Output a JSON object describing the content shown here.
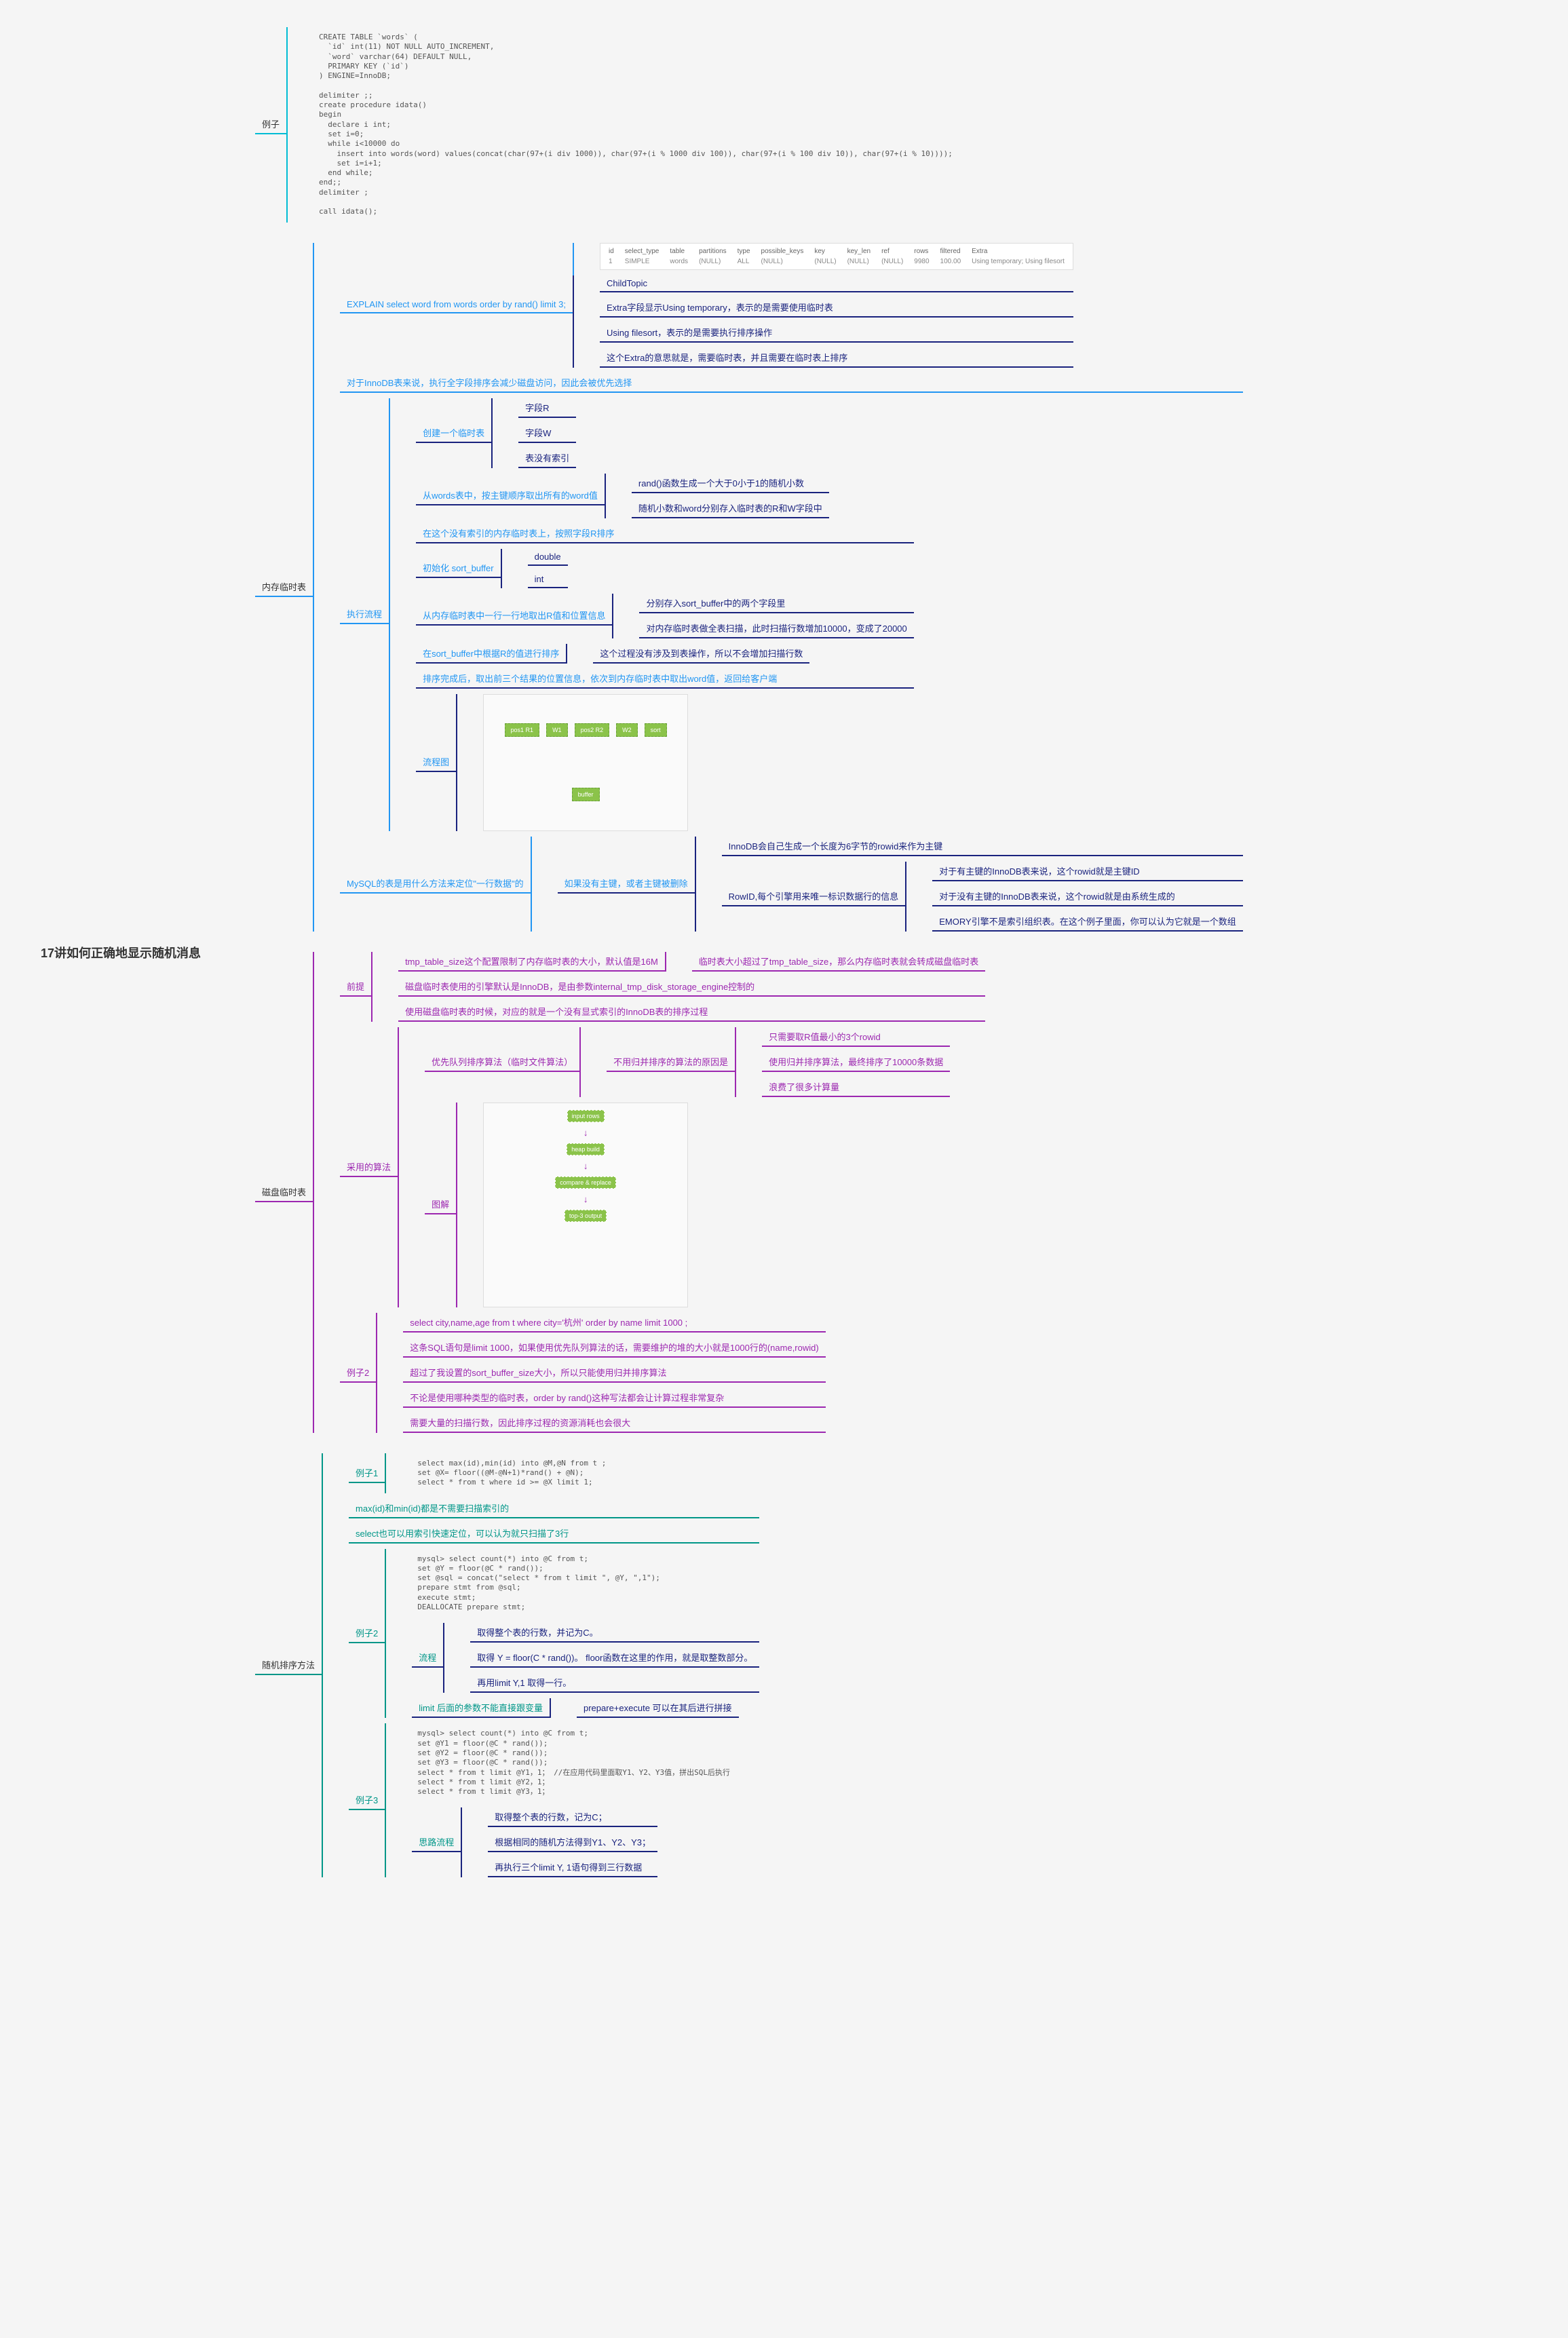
{
  "root": "17讲如何正确地显示随机消息",
  "example": {
    "title": "例子",
    "code": "CREATE TABLE `words` (\n  `id` int(11) NOT NULL AUTO_INCREMENT,\n  `word` varchar(64) DEFAULT NULL,\n  PRIMARY KEY (`id`)\n) ENGINE=InnoDB;\n\ndelimiter ;;\ncreate procedure idata()\nbegin\n  declare i int;\n  set i=0;\n  while i<10000 do\n    insert into words(word) values(concat(char(97+(i div 1000)), char(97+(i % 1000 div 100)), char(97+(i % 100 div 10)), char(97+(i % 10))));\n    set i=i+1;\n  end while;\nend;;\ndelimiter ;\n\ncall idata();"
  },
  "mem": {
    "title": "内存临时表",
    "explain_sql": "EXPLAIN select word from words order by rand() limit 3;",
    "explain_header": [
      "id",
      "select_type",
      "table",
      "partitions",
      "type",
      "possible_keys",
      "key",
      "key_len",
      "ref",
      "rows",
      "filtered",
      "Extra"
    ],
    "explain_row": [
      "1",
      "SIMPLE",
      "words",
      "(NULL)",
      "ALL",
      "(NULL)",
      "(NULL)",
      "(NULL)",
      "(NULL)",
      "9980",
      "100.00",
      "Using temporary; Using filesort"
    ],
    "explain_notes": {
      "n0": "ChildTopic",
      "n1": "Extra字段显示Using temporary，表示的是需要使用临时表",
      "n2": "Using filesort，表示的是需要执行排序操作",
      "n3": "这个Extra的意思就是，需要临时表，并且需要在临时表上排序"
    },
    "innodb_note": "对于InnoDB表来说，执行全字段排序会减少磁盘访问，因此会被优先选择",
    "flow": {
      "title": "执行流程",
      "create": "创建一个临时表",
      "create_c1": "字段R",
      "create_c2": "字段W",
      "create_c3": "表没有索引",
      "from_words": "从words表中，按主键顺序取出所有的word值",
      "from_words_c1": "rand()函数生成一个大于0小于1的随机小数",
      "from_words_c2": "随机小数和word分别存入临时表的R和W字段中",
      "sort_on": "在这个没有索引的内存临时表上，按照字段R排序",
      "init_buf": "初始化 sort_buffer",
      "init_buf_c1": "double",
      "init_buf_c2": "int",
      "extract": "从内存临时表中一行一行地取出R值和位置信息",
      "extract_c1": "分别存入sort_buffer中的两个字段里",
      "extract_c2": "对内存临时表做全表扫描，此时扫描行数增加10000，变成了20000",
      "sort_buf": "在sort_buffer中根据R的值进行排序",
      "sort_buf_note": "这个过程没有涉及到表操作，所以不会增加扫描行数",
      "done": "排序完成后，取出前三个结果的位置信息，依次到内存临时表中取出word值，返回给客户端",
      "diagram": "流程图"
    },
    "rowid": {
      "q": "MySQL的表是用什么方法来定位\"一行数据\"的",
      "a": "如果没有主键，或者主键被删除",
      "innodb_auto": "InnoDB会自己生成一个长度为6字节的rowid来作为主键",
      "rowid_def": "RowID,每个引擎用来唯一标识数据行的信息",
      "r1": "对于有主键的InnoDB表来说，这个rowid就是主键ID",
      "r2": "对于没有主键的InnoDB表来说，这个rowid就是由系统生成的",
      "r3": "EMORY引擎不是索引组织表。在这个例子里面，你可以认为它就是一个数组"
    }
  },
  "disk": {
    "title": "磁盘临时表",
    "pre": {
      "title": "前提",
      "p1": "tmp_table_size这个配置限制了内存临时表的大小，默认值是16M",
      "p1_note": "临时表大小超过了tmp_table_size，那么内存临时表就会转成磁盘临时表",
      "p2": "磁盘临时表使用的引擎默认是InnoDB，是由参数internal_tmp_disk_storage_engine控制的",
      "p3": "使用磁盘临时表的时候，对应的就是一个没有显式索引的InnoDB表的排序过程"
    },
    "algo": {
      "title": "采用的算法",
      "priority": "优先队列排序算法（临时文件算法）",
      "reason": "不用归并排序的算法的原因是",
      "r1": "只需要取R值最小的3个rowid",
      "r2": "使用归并排序算法，最终排序了10000条数据",
      "r3": "浪费了很多计算量",
      "diagram": "图解"
    },
    "ex2": {
      "title": "例子2",
      "sql": "select city,name,age from t where city='杭州' order by name limit 1000  ;",
      "n1": "这条SQL语句是limit 1000，如果使用优先队列算法的话，需要维护的堆的大小就是1000行的(name,rowid)",
      "n2": "超过了我设置的sort_buffer_size大小，所以只能使用归并排序算法",
      "n3": "不论是使用哪种类型的临时表，order by rand()这种写法都会让计算过程非常复杂",
      "n4": "需要大量的扫描行数，因此排序过程的资源消耗也会很大"
    }
  },
  "random": {
    "title": "随机排序方法",
    "ex1": {
      "title": "例子1",
      "code": "select max(id),min(id) into @M,@N from t ;\nset @X= floor((@M-@N+1)*rand() + @N);\nselect * from t where id >= @X limit 1;"
    },
    "note1": "max(id)和min(id)都是不需要扫描索引的",
    "note2": "select也可以用索引快速定位，可以认为就只扫描了3行",
    "ex2": {
      "title": "例子2",
      "code": "mysql> select count(*) into @C from t;\nset @Y = floor(@C * rand());\nset @sql = concat(\"select * from t limit \", @Y, \",1\");\nprepare stmt from @sql;\nexecute stmt;\nDEALLOCATE prepare stmt;",
      "flow": "流程",
      "f1": "取得整个表的行数，并记为C。",
      "f2": "取得 Y = floor(C * rand())。 floor函数在这里的作用，就是取整数部分。",
      "f3": "再用limit Y,1 取得一行。",
      "limit_note": "limit 后面的参数不能直接跟变量",
      "limit_sol": "prepare+execute 可以在其后进行拼接"
    },
    "ex3": {
      "title": "例子3",
      "code": "mysql> select count(*) into @C from t;\nset @Y1 = floor(@C * rand());\nset @Y2 = floor(@C * rand());\nset @Y3 = floor(@C * rand());\nselect * from t limit @Y1，1； //在应用代码里面取Y1、Y2、Y3值，拼出SQL后执行\nselect * from t limit @Y2，1；\nselect * from t limit @Y3，1；",
      "flow": "思路流程",
      "f1": "取得整个表的行数，记为C；",
      "f2": "根据相同的随机方法得到Y1、Y2、Y3；",
      "f3": "再执行三个limit Y, 1语句得到三行数据"
    }
  }
}
